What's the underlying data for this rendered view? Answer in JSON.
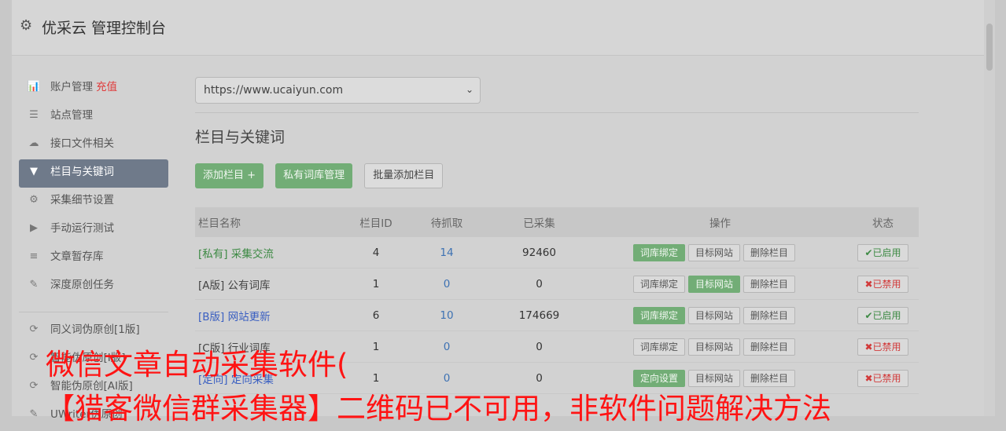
{
  "header": {
    "icon": "gear-icon",
    "title": "优采云 管理控制台"
  },
  "sidebar": {
    "items": [
      {
        "icon": "bar-chart-icon",
        "glyph": "📊",
        "label": "账户管理",
        "extra": "充值"
      },
      {
        "icon": "server-icon",
        "glyph": "☰",
        "label": "站点管理"
      },
      {
        "icon": "cloud-upload-icon",
        "glyph": "☁",
        "label": "接口文件相关"
      },
      {
        "icon": "filter-icon",
        "glyph": "▼",
        "label": "栏目与关键词",
        "active": true
      },
      {
        "icon": "cogs-icon",
        "glyph": "⚙",
        "label": "采集细节设置"
      },
      {
        "icon": "play-circle-icon",
        "glyph": "▶",
        "label": "手动运行测试"
      },
      {
        "icon": "database-icon",
        "glyph": "≡",
        "label": "文章暂存库"
      },
      {
        "icon": "edit-icon",
        "glyph": "✎",
        "label": "深度原创任务"
      }
    ],
    "items2": [
      {
        "icon": "refresh-icon",
        "glyph": "⟳",
        "label": "同义词伪原创[1版]"
      },
      {
        "icon": "refresh-icon",
        "glyph": "⟳",
        "label": "智能伪原创[I版]"
      },
      {
        "icon": "refresh-icon",
        "glyph": "⟳",
        "label": "智能伪原创[AI版]"
      },
      {
        "icon": "edit-icon",
        "glyph": "✎",
        "label": "UWriter伪原创"
      }
    ]
  },
  "main": {
    "site_select": "https://www.ucaiyun.com",
    "section_title": "栏目与关键词",
    "buttons": {
      "add": "添加栏目 +",
      "private": "私有词库管理",
      "batch": "批量添加栏目"
    },
    "table": {
      "headers": [
        "栏目名称",
        "栏目ID",
        "待抓取",
        "已采集",
        "操作",
        "状态"
      ],
      "rows": [
        {
          "name": "[私有] 采集交流",
          "name_color": "green",
          "id": "4",
          "pending": "14",
          "done": "92460",
          "op1": "词库绑定",
          "op1_on": true,
          "op2": "目标网站",
          "op2_on": false,
          "op3": "删除栏目",
          "state": "✔已启用",
          "state_on": true
        },
        {
          "name": "[A版] 公有词库",
          "name_color": "dark",
          "id": "1",
          "pending": "0",
          "done": "0",
          "op1": "词库绑定",
          "op1_on": false,
          "op2": "目标网站",
          "op2_on": true,
          "op3": "删除栏目",
          "state": "✖已禁用",
          "state_on": false
        },
        {
          "name": "[B版] 网站更新",
          "name_color": "blue",
          "id": "6",
          "pending": "10",
          "done": "174669",
          "op1": "词库绑定",
          "op1_on": true,
          "op2": "目标网站",
          "op2_on": false,
          "op3": "删除栏目",
          "state": "✔已启用",
          "state_on": true
        },
        {
          "name": "[C版] 行业词库",
          "name_color": "dark",
          "id": "1",
          "pending": "0",
          "done": "0",
          "op1": "词库绑定",
          "op1_on": false,
          "op2": "目标网站",
          "op2_on": false,
          "op3": "删除栏目",
          "state": "✖已禁用",
          "state_on": false
        },
        {
          "name": "[定向] 定向采集",
          "name_color": "blue",
          "id": "1",
          "pending": "0",
          "done": "0",
          "op1": "定向设置",
          "op1_on": true,
          "op2": "目标网站",
          "op2_on": false,
          "op3": "删除栏目",
          "state": "✖已禁用",
          "state_on": false
        }
      ]
    }
  },
  "overlay": {
    "line1": "微信文章自动采集软件(",
    "line2": "【猎客微信群采集器】二维码已不可用，非软件问题解决方法"
  }
}
